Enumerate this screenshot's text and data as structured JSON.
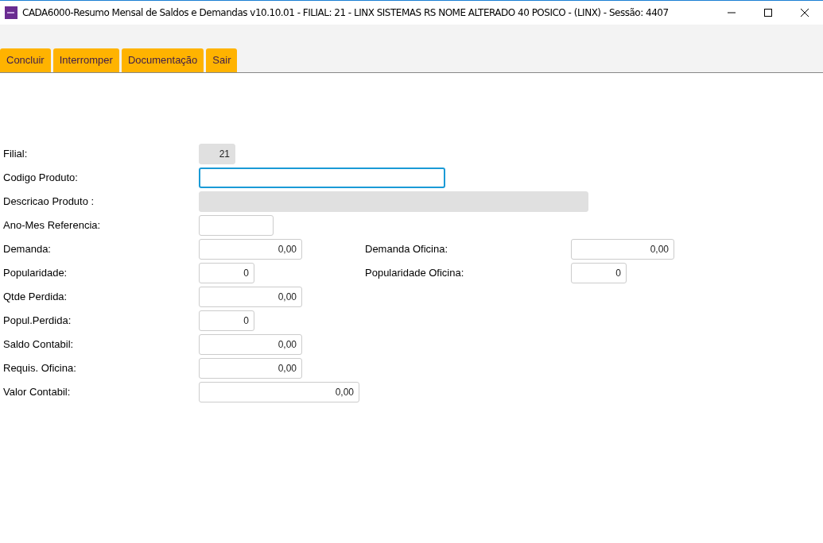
{
  "window": {
    "title": "CADA6000-Resumo Mensal de Saldos e Demandas v10.10.01   - FILIAL: 21 - LINX SISTEMAS RS NOME ALTERADO 40 POSICO - (LINX) - Sessão: 4407"
  },
  "toolbar": [
    "Concluir",
    "Interromper",
    "Documentação",
    "Sair"
  ],
  "rows": [
    {
      "label": "Filial:",
      "field": {
        "value": "21",
        "readonly": true,
        "focused": false
      }
    },
    {
      "label": "Codigo Produto:",
      "field": {
        "readonly": false,
        "focused": true
      }
    },
    {
      "label": "Descricao Produto :",
      "field": {
        "readonly": true,
        "focused": false
      }
    },
    {
      "label": "Ano-Mes Referencia:",
      "field": {
        "readonly": false,
        "focused": false
      }
    },
    {
      "label": "Demanda:",
      "field": {
        "value": "0,00",
        "readonly": false,
        "focused": false
      },
      "side": {
        "label": "Demanda Oficina:",
        "field": {
          "value": "0,00",
          "readonly": false,
          "focused": false
        }
      }
    },
    {
      "label": "Popularidade:",
      "field": {
        "value": "0",
        "readonly": false,
        "focused": false
      },
      "side": {
        "label": "Popularidade Oficina:",
        "field": {
          "value": "0",
          "readonly": false,
          "focused": false
        }
      }
    },
    {
      "label": "Qtde Perdida:",
      "field": {
        "value": "0,00",
        "readonly": false,
        "focused": false
      }
    },
    {
      "label": "Popul.Perdida:",
      "field": {
        "value": "0",
        "readonly": false,
        "focused": false
      }
    },
    {
      "label": "Saldo Contabil:",
      "field": {
        "value": "0,00",
        "readonly": false,
        "focused": false
      }
    },
    {
      "label": "Requis. Oficina:",
      "field": {
        "value": "0,00",
        "readonly": false,
        "focused": false
      }
    },
    {
      "label": "Valor Contabil:",
      "field": {
        "value": "0,00",
        "readonly": false,
        "focused": false
      }
    }
  ]
}
